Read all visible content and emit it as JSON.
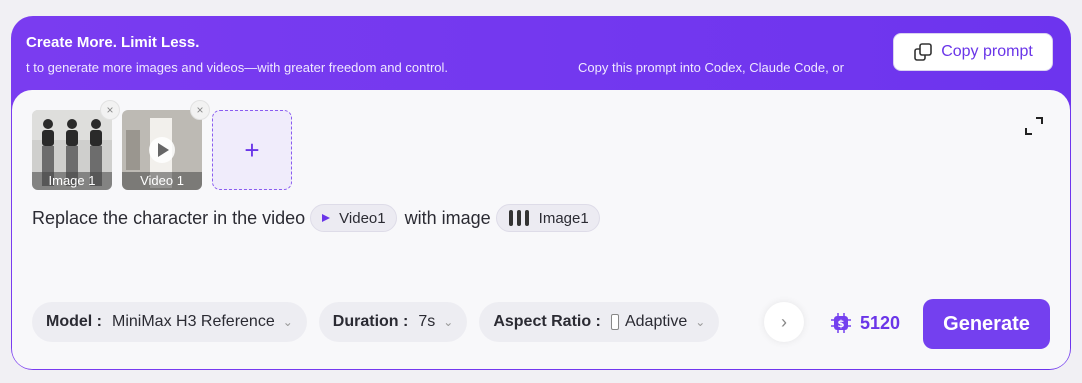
{
  "banner": {
    "title": "Create More. Limit Less.",
    "marquee_left": "t to generate more images and videos—with greater freedom and control.",
    "marquee_right": "Copy this prompt into Codex, Claude Code, or",
    "copy_button": "Copy prompt"
  },
  "attachments": [
    {
      "caption": "Image 1",
      "remove_icon": "×"
    },
    {
      "caption": "Video 1",
      "remove_icon": "×"
    }
  ],
  "add_tile_icon": "+",
  "prompt": {
    "text_before": "Replace the character in the video",
    "video_chip": "Video1",
    "text_middle": "with image",
    "image_chip": "Image1"
  },
  "controls": {
    "model_label": "Model :",
    "model_value": "MiniMax H3 Reference",
    "duration_label": "Duration :",
    "duration_value": "7s",
    "aspect_label": "Aspect Ratio :",
    "aspect_value": "Adaptive",
    "next_icon": "›"
  },
  "credits": "5120",
  "generate": "Generate",
  "accent_color": "#7440ef"
}
